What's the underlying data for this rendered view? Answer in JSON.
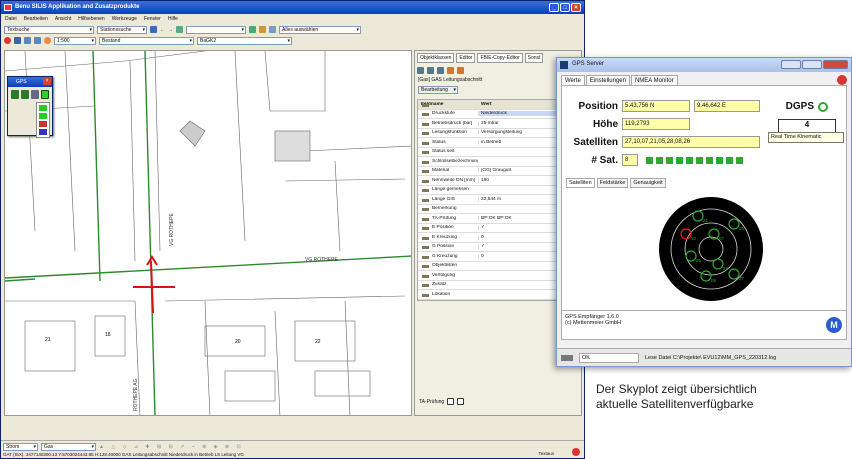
{
  "main": {
    "title": "Benu SILIS Applikation and Zusatzprodukte",
    "menu": [
      "Datei",
      "Bearbeiten",
      "Ansicht",
      "Hilfsebenen",
      "Werkzeuge",
      "Fenster",
      "Hilfe"
    ],
    "tb1": {
      "combo1": "Textsuche",
      "combo2": "Stationssuche",
      "combo3": "Alles auswählen"
    },
    "tb2": {
      "scale": "1:500",
      "combo1": "Bestand",
      "combo2": "BaGK2"
    },
    "map_labels": {
      "street1": "VG ROTHEPE",
      "street2": "VG ROTHEPE",
      "street3": "ROTHEPE AG",
      "n1": "21",
      "n2": "18",
      "n3": "20",
      "n4": "22"
    },
    "statusbar": {
      "strom": "Strom",
      "gas": "Gas",
      "coord": "GAT (ISX): 3477140300.13  Y:5703024443.95  H:128.40000  GAS Leitungsabschnitt Niederdruck  in Betrieb  LS Leitung VG",
      "right": "Textaus"
    }
  },
  "gps_small": {
    "title": "GPS"
  },
  "panel": {
    "tabs": [
      "Objektklassen",
      "Editor",
      "FBIE-Copy-Editor",
      "Sonst"
    ],
    "object": "[Gas] GAS Leitungsabschnitt",
    "button": "Bearbeitung",
    "col_name": "Feldname",
    "col_value": "Wert",
    "rows": [
      {
        "n": "Druckstufe",
        "v": "Niederdruck"
      },
      {
        "n": "Betriebsdruck [bar]",
        "v": "25 mbar"
      },
      {
        "n": "Leitungsfunktion",
        "v": "Versorgungsleitung"
      },
      {
        "n": "Status",
        "v": "in Betrieb"
      },
      {
        "n": "Status seit",
        "v": ""
      },
      {
        "n": "Schlüsselbezeichnung",
        "v": ""
      },
      {
        "n": "Material",
        "v": "[GG] Grauguß"
      },
      {
        "n": "Nennweite DN [mm]",
        "v": "150"
      },
      {
        "n": "Länge gemessen",
        "v": ""
      },
      {
        "n": "Länge GIS",
        "v": "22,544 m"
      },
      {
        "n": "Bemerkung",
        "v": ""
      },
      {
        "n": "TA-Prüfung",
        "v": "BP:OK BP:OK"
      },
      {
        "n": "E Position",
        "v": "✓"
      },
      {
        "n": "E Kreuzung",
        "v": "0"
      },
      {
        "n": "G Position",
        "v": "✓"
      },
      {
        "n": "G Kreuzung",
        "v": "0"
      },
      {
        "n": "Objektlisten",
        "v": ""
      },
      {
        "n": "Verfolgung",
        "v": ""
      },
      {
        "n": "Zusatz",
        "v": ""
      },
      {
        "n": "Lokation",
        "v": ""
      }
    ],
    "bottom": "TA-Prüfung"
  },
  "gps_server": {
    "title": "GPS Server",
    "tabs": [
      "Werte",
      "Einstellungen",
      "NMEA Monitor"
    ],
    "position_label": "Position",
    "position_n": "5.43,756 N",
    "position_e": "9.46,642 E",
    "hoehe_label": "Höhe",
    "hoehe": "119,2793",
    "sat_label": "Satelliten",
    "sat_list": "27,10,07,21,05,28,08,26",
    "nsat_label": "# Sat.",
    "nsat": "8",
    "dgps_label": "DGPS",
    "dgps_value": "4",
    "rtk": "Real Time Kinematic",
    "subtabs": [
      "Satelliten",
      "Feldstärke",
      "Genauigkeit"
    ],
    "info1": "GPS Empfänger 1.6.0",
    "info2": "(c) Mettenmeier GmbH",
    "ok": "OK",
    "status": "Lese Datei C:\\Projekte\\ EVU12\\MM_GPS_220312.log",
    "satellites": [
      "21",
      "10",
      "26",
      "07",
      "05",
      "28",
      "08",
      "27"
    ]
  },
  "caption": {
    "line1": "Der Skyplot zeigt übersichtlich",
    "line2": "aktuelle Satellitenverfügbarke"
  },
  "colors": {
    "gas": "#2d8a2d",
    "accent": "#0a3fbf",
    "dgps": "#2fa832",
    "yellow": "#ffffa8"
  }
}
